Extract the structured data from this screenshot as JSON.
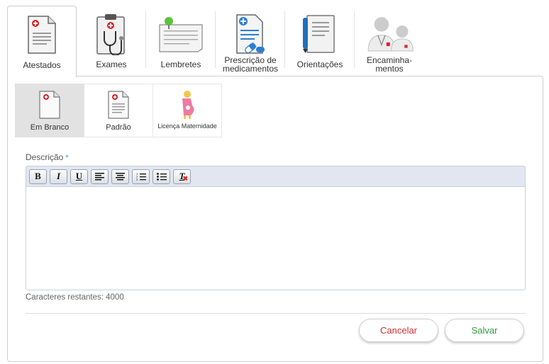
{
  "tabs": [
    {
      "label": "Atestados",
      "icon": "medical-certificate-icon",
      "active": true
    },
    {
      "label": "Exames",
      "icon": "clipboard-stethoscope-icon"
    },
    {
      "label": "Lembretes",
      "icon": "pinned-note-icon"
    },
    {
      "label": "Prescrição de medicamentos",
      "icon": "prescription-pills-icon"
    },
    {
      "label": "Orientações",
      "icon": "notebook-pen-icon"
    },
    {
      "label": "Encaminha-mentos",
      "icon": "doctors-icon"
    }
  ],
  "subtabs": [
    {
      "label": "Em Branco",
      "icon": "blank-document-icon",
      "active": true
    },
    {
      "label": "Padrão",
      "icon": "standard-document-icon"
    },
    {
      "label": "Licença Maternidade",
      "icon": "pregnant-woman-icon"
    }
  ],
  "form": {
    "description_label": "Descrição",
    "required_mark": "*",
    "counter_text": "Caracteres restantes: 4000",
    "description_value": ""
  },
  "toolbar": {
    "bold": "B",
    "italic": "I",
    "underline": "U",
    "clear_format": "T"
  },
  "actions": {
    "cancel": "Cancelar",
    "save": "Salvar"
  },
  "colors": {
    "accent_blue": "#2a9de0",
    "cancel_red": "#d32f2f",
    "save_green": "#2e9e3a",
    "medical_red": "#d9262c"
  }
}
